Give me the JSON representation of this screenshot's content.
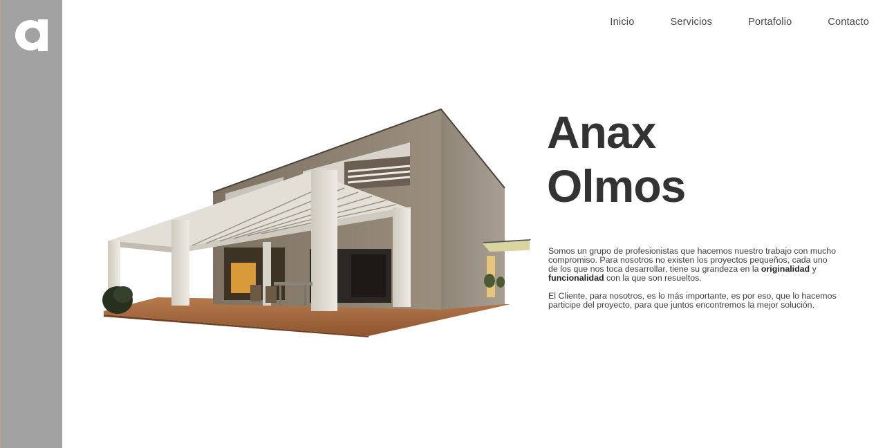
{
  "brand": {
    "logo_letter": "a",
    "sidebar_color": "#a2a2a2"
  },
  "nav": {
    "items": [
      {
        "label": "Inicio"
      },
      {
        "label": "Servicios"
      },
      {
        "label": "Portafolio"
      },
      {
        "label": "Contacto"
      }
    ]
  },
  "hero": {
    "title_line1": "Anax",
    "title_line2": "Olmos",
    "image_icon": "house-illustration",
    "p1_start": "Somos un grupo de profesionistas que hacemos nuestro trabajo con mucho compromiso. Para nosotros no existen los proyectos pequeños, cada uno de los que nos toca desarrollar, tiene su grandeza en la ",
    "p1_bold1": "originalidad",
    "p1_mid": " y ",
    "p1_bold2": "funcionalidad",
    "p1_end": " con la que son resueltos.",
    "p2": "El Cliente, para nosotros, es lo más importante, es por eso, que lo hacemos participe del proyecto, para que juntos encontremos la mejor solución."
  }
}
